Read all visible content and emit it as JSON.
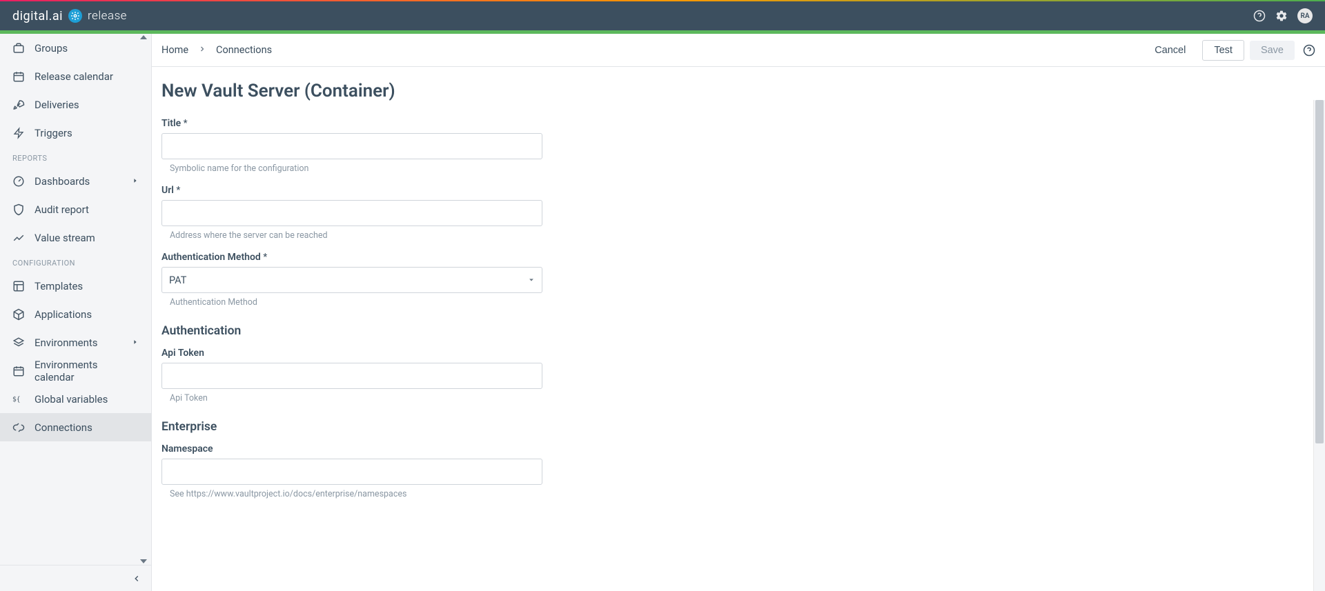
{
  "brand": {
    "name": "digital.ai",
    "product": "release"
  },
  "topbar": {
    "avatar_initials": "RA"
  },
  "sidebar": {
    "items_top": [
      {
        "label": "Groups",
        "icon": "briefcase"
      },
      {
        "label": "Release calendar",
        "icon": "calendar"
      },
      {
        "label": "Deliveries",
        "icon": "rocket"
      },
      {
        "label": "Triggers",
        "icon": "bolt"
      }
    ],
    "section_reports": "REPORTS",
    "items_reports": [
      {
        "label": "Dashboards",
        "icon": "gauge",
        "chevron": true
      },
      {
        "label": "Audit report",
        "icon": "shield"
      },
      {
        "label": "Value stream",
        "icon": "trend"
      }
    ],
    "section_config": "CONFIGURATION",
    "items_config": [
      {
        "label": "Templates",
        "icon": "template"
      },
      {
        "label": "Applications",
        "icon": "cube"
      },
      {
        "label": "Environments",
        "icon": "stack",
        "chevron": true
      },
      {
        "label": "Environments calendar",
        "icon": "calendar"
      },
      {
        "label": "Global variables",
        "icon": "dollar-braces"
      },
      {
        "label": "Connections",
        "icon": "plug",
        "active": true
      }
    ]
  },
  "breadcrumb": {
    "items": [
      "Home",
      "Connections"
    ]
  },
  "actions": {
    "cancel": "Cancel",
    "test": "Test",
    "save": "Save"
  },
  "form": {
    "title": "New Vault Server (Container)",
    "fields": {
      "title": {
        "label": "Title",
        "required": "*",
        "help": "Symbolic name for the configuration"
      },
      "url": {
        "label": "Url",
        "required": "*",
        "help": "Address where the server can be reached"
      },
      "auth_method": {
        "label": "Authentication Method",
        "required": "*",
        "value": "PAT",
        "help": "Authentication Method"
      }
    },
    "section_auth": "Authentication",
    "api_token": {
      "label": "Api Token",
      "help": "Api Token"
    },
    "section_enterprise": "Enterprise",
    "namespace": {
      "label": "Namespace",
      "help": "See https://www.vaultproject.io/docs/enterprise/namespaces"
    }
  }
}
